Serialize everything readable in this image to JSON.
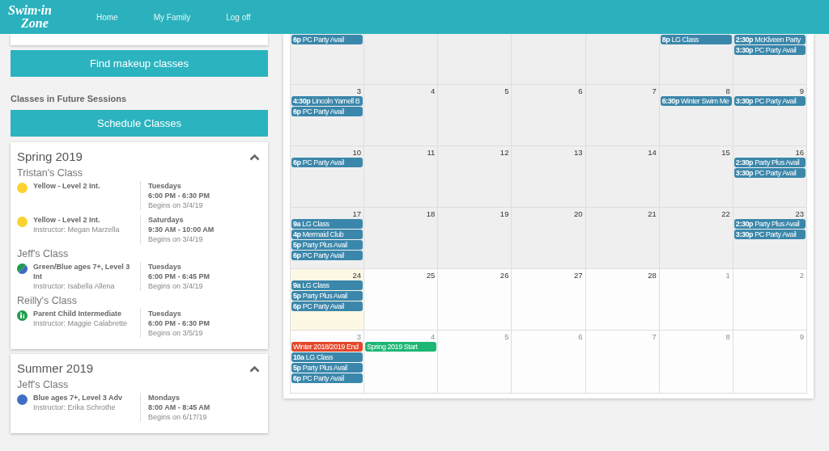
{
  "header": {
    "logo": [
      "Swim·in",
      "Zone"
    ],
    "nav": [
      "Home",
      "My Family",
      "Log off"
    ]
  },
  "sidebar": {
    "find_button": "Find makeup classes",
    "section_title": "Classes in Future Sessions",
    "schedule_button": "Schedule Classes"
  },
  "sessions": [
    {
      "title": "Spring 2019",
      "expanded": true,
      "students": [
        {
          "name": "Tristan's Class",
          "classes": [
            {
              "kind": "dot",
              "color": "#fcd22f",
              "class_name": "Yellow - Level 2 Int.",
              "day": "Tuesdays",
              "time": "6:00 PM - 6:30 PM",
              "begins": "Begins on 3/4/19"
            },
            {
              "kind": "dot",
              "color": "#fcd22f",
              "class_name": "Yellow - Level 2 Int.",
              "instructor": "Instructor: Megan Marzella",
              "day": "Saturdays",
              "time": "9:30 AM - 10:00 AM",
              "begins": "Begins on 3/4/19"
            }
          ]
        },
        {
          "name": "Jeff's Class",
          "classes": [
            {
              "kind": "split",
              "halves": [
                {
                  "color": "#1e9b4b"
                },
                {
                  "color": "#3d6cc4"
                }
              ],
              "class_name": "Green/Blue ages 7+, Level 3 Int",
              "instructor": "Instructor: Isabella Allena",
              "day": "Tuesdays",
              "time": "6:00 PM - 6:45 PM",
              "begins": "Begins on 3/4/19"
            }
          ]
        },
        {
          "name": "Reilly's Class",
          "classes": [
            {
              "kind": "parent-child",
              "color": "#1f9d4d",
              "class_name": "Parent Child Intermediate",
              "instructor": "Instructor: Maggie Calabrette",
              "day": "Tuesdays",
              "time": "6:00 PM - 6:30 PM",
              "begins": "Begins on 3/5/19"
            }
          ]
        }
      ]
    },
    {
      "title": "Summer 2019",
      "expanded": true,
      "students": [
        {
          "name": "Jeff's Class",
          "classes": [
            {
              "kind": "dot",
              "color": "#3e6fc5",
              "class_name": "Blue ages 7+, Level 3 Adv",
              "instructor": "Instructor: Erika Schrothe",
              "day": "Mondays",
              "time": "8:00 AM - 8:45 AM",
              "begins": "Begins on 6/17/19"
            }
          ]
        }
      ]
    }
  ],
  "calendar": {
    "weeks": [
      {
        "past": true,
        "days": [
          {
            "today": false,
            "events": [
              {
                "time": "6p",
                "title": "PC Party Avail",
                "color": "#3b87ab"
              }
            ]
          },
          {
            "today": false
          },
          {
            "today": false
          },
          {
            "today": false
          },
          {
            "today": false
          },
          {
            "today": false,
            "events": [
              {
                "time": "8p",
                "title": "LG Class",
                "color": "#3b87ab"
              }
            ]
          },
          {
            "today": false,
            "events": [
              {
                "time": "2:30p",
                "title": "McKlveen Party",
                "color": "#3b87ab"
              },
              {
                "time": "3:30p",
                "title": "PC Party Avail",
                "color": "#3b87ab"
              }
            ]
          }
        ]
      },
      {
        "past": true,
        "days": [
          {
            "day": "3",
            "today": false,
            "other_month": false,
            "events": [
              {
                "time": "4:30p",
                "title": "Lincoln Yarnell B",
                "color": "#3b87ab"
              },
              {
                "time": "6p",
                "title": "PC Party Avail",
                "color": "#3b87ab"
              }
            ]
          },
          {
            "day": "4",
            "today": false,
            "other_month": false
          },
          {
            "day": "5",
            "today": false,
            "other_month": false
          },
          {
            "day": "6",
            "today": false,
            "other_month": false
          },
          {
            "day": "7",
            "today": false,
            "other_month": false
          },
          {
            "day": "8",
            "today": false,
            "other_month": false,
            "events": [
              {
                "time": "6:30p",
                "title": "Winter Swim Me",
                "color": "#3b87ab"
              }
            ]
          },
          {
            "day": "9",
            "today": false,
            "other_month": false,
            "events": [
              {
                "time": "3:30p",
                "title": "PC Party Avail",
                "color": "#3b87ab"
              }
            ]
          }
        ]
      },
      {
        "past": true,
        "days": [
          {
            "day": "10",
            "today": false,
            "other_month": false,
            "events": [
              {
                "time": "6p",
                "title": "PC Party Avail",
                "color": "#3b87ab"
              }
            ]
          },
          {
            "day": "11",
            "today": false,
            "other_month": false
          },
          {
            "day": "12",
            "today": false,
            "other_month": false
          },
          {
            "day": "13",
            "today": false,
            "other_month": false
          },
          {
            "day": "14",
            "today": false,
            "other_month": false
          },
          {
            "day": "15",
            "today": false,
            "other_month": false
          },
          {
            "day": "16",
            "today": false,
            "other_month": false,
            "events": [
              {
                "time": "2:30p",
                "title": "Party Plus Avail",
                "color": "#3b87ab"
              },
              {
                "time": "3:30p",
                "title": "PC Party Avail",
                "color": "#3b87ab"
              }
            ]
          }
        ]
      },
      {
        "past": true,
        "days": [
          {
            "day": "17",
            "today": false,
            "other_month": false,
            "events": [
              {
                "time": "9a",
                "title": "LG Class",
                "color": "#3b87ab"
              },
              {
                "time": "4p",
                "title": "Mermaid Club",
                "color": "#3b87ab"
              },
              {
                "time": "5p",
                "title": "Party Plus Avail",
                "color": "#3b87ab"
              },
              {
                "time": "6p",
                "title": "PC Party Avail",
                "color": "#3b87ab"
              }
            ]
          },
          {
            "day": "18",
            "today": false,
            "other_month": false
          },
          {
            "day": "19",
            "today": false,
            "other_month": false
          },
          {
            "day": "20",
            "today": false,
            "other_month": false
          },
          {
            "day": "21",
            "today": false,
            "other_month": false
          },
          {
            "day": "22",
            "today": false,
            "other_month": false
          },
          {
            "day": "23",
            "today": false,
            "other_month": false,
            "events": [
              {
                "time": "2:30p",
                "title": "Party Plus Avail",
                "color": "#3b87ab"
              },
              {
                "time": "3:30p",
                "title": "PC Party Avail",
                "color": "#3b87ab"
              }
            ]
          }
        ]
      },
      {
        "past": false,
        "days": [
          {
            "day": "24",
            "today": true,
            "other_month": false,
            "events": [
              {
                "time": "9a",
                "title": "LG Class",
                "color": "#3b87ab"
              },
              {
                "time": "5p",
                "title": "Party Plus Avail",
                "color": "#3b87ab"
              },
              {
                "time": "6p",
                "title": "PC Party Avail",
                "color": "#3b87ab"
              }
            ]
          },
          {
            "day": "25",
            "today": false,
            "other_month": false
          },
          {
            "day": "26",
            "today": false,
            "other_month": false
          },
          {
            "day": "27",
            "today": false,
            "other_month": false
          },
          {
            "day": "28",
            "today": false,
            "other_month": false
          },
          {
            "day": "1",
            "today": false,
            "other_month": true
          },
          {
            "day": "2",
            "today": false,
            "other_month": true
          }
        ]
      },
      {
        "past": false,
        "days": [
          {
            "day": "3",
            "today": false,
            "other_month": true,
            "events": [
              {
                "title": "Winter 2018/2019 End",
                "color": "#e4472a"
              },
              {
                "time": "10a",
                "title": "LG Class",
                "color": "#3b87ab"
              },
              {
                "time": "5p",
                "title": "Party Plus Avail",
                "color": "#3b87ab"
              },
              {
                "time": "6p",
                "title": "PC Party Avail",
                "color": "#3b87ab"
              }
            ]
          },
          {
            "day": "4",
            "today": false,
            "other_month": true,
            "events": [
              {
                "title": "Spring 2019 Start",
                "color": "#1db674"
              }
            ]
          },
          {
            "day": "5",
            "today": false,
            "other_month": true
          },
          {
            "day": "6",
            "today": false,
            "other_month": true
          },
          {
            "day": "7",
            "today": false,
            "other_month": true
          },
          {
            "day": "8",
            "today": false,
            "other_month": true
          },
          {
            "day": "9",
            "today": false,
            "other_month": true
          }
        ]
      }
    ]
  }
}
